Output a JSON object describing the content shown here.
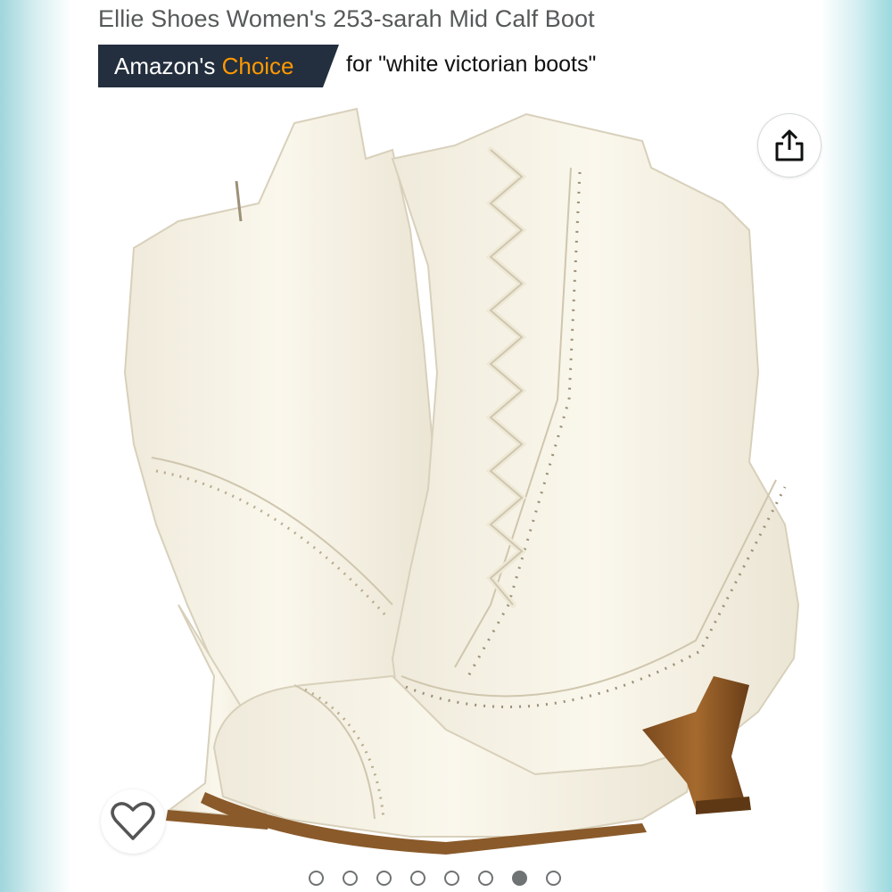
{
  "product": {
    "title": "Ellie Shoes Women's 253-sarah Mid Calf Boot"
  },
  "badge": {
    "prefix": "Amazon's",
    "highlight": "Choice",
    "suffix": "for \"white victorian boots\"",
    "colors": {
      "background": "#232f3e",
      "highlight": "#ff9900",
      "text": "#ffffff"
    }
  },
  "gallery": {
    "image_subject": "white victorian lace-up mid calf boots",
    "total_images": 8,
    "active_index": 7
  },
  "icons": {
    "share": "share-icon",
    "wishlist": "heart-icon"
  }
}
